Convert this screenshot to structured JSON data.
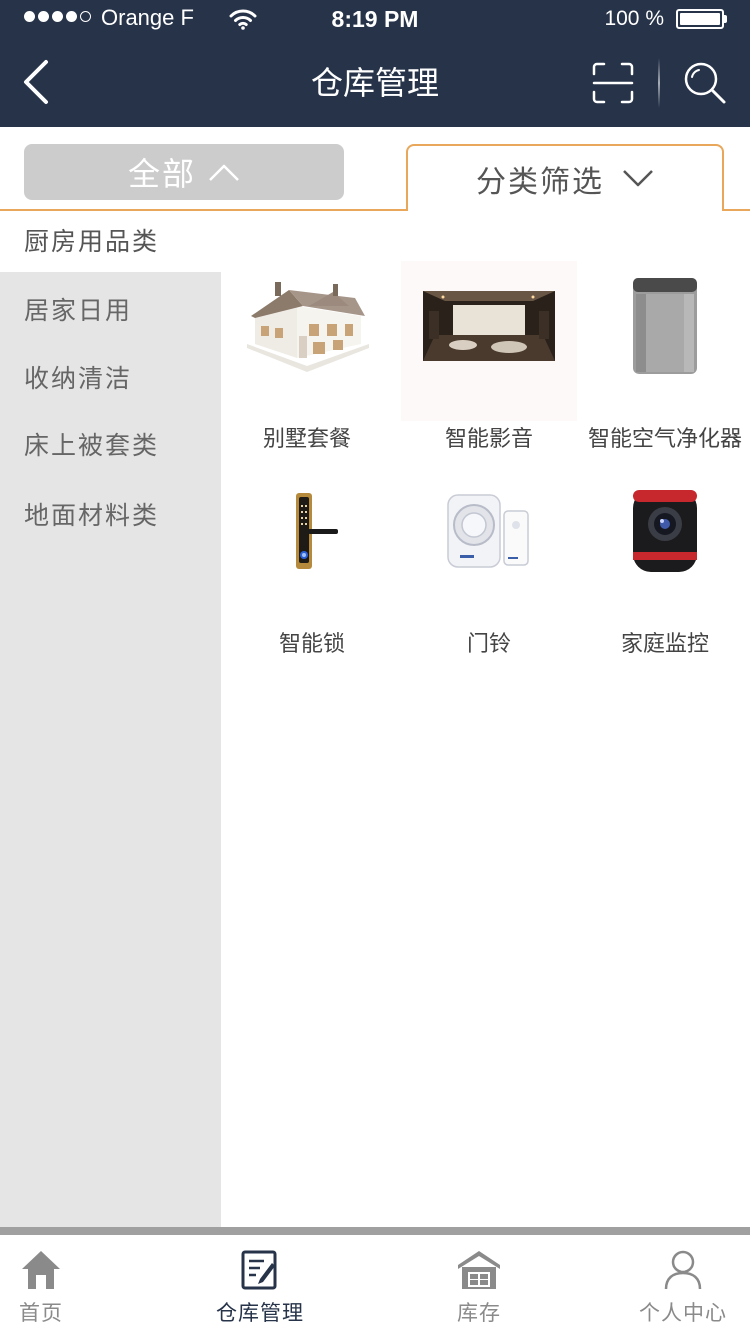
{
  "status_bar": {
    "carrier": "Orange F",
    "time": "8:19 PM",
    "battery": "100 %"
  },
  "nav": {
    "title": "仓库管理",
    "icons": [
      "chevron-left-icon",
      "scan-icon",
      "search-icon"
    ]
  },
  "filters": {
    "all_label": "全部",
    "category_label": "分类筛选"
  },
  "categories": [
    "厨房用品类",
    "居家日用",
    "收纳清洁",
    "床上被套类",
    "地面材料类"
  ],
  "products": [
    {
      "label": "别墅套餐",
      "icon": "villa-image"
    },
    {
      "label": "智能影音",
      "icon": "home-theater-image"
    },
    {
      "label": "智能空气净化器",
      "icon": "air-purifier-image"
    },
    {
      "label": "智能锁",
      "icon": "smart-lock-image"
    },
    {
      "label": "门铃",
      "icon": "doorbell-image"
    },
    {
      "label": "家庭监控",
      "icon": "security-camera-image"
    }
  ],
  "tabbar": {
    "items": [
      {
        "label": "首页",
        "icon": "home-icon",
        "active": false
      },
      {
        "label": "仓库管理",
        "icon": "edit-document-icon",
        "active": true
      },
      {
        "label": "库存",
        "icon": "warehouse-icon",
        "active": false
      },
      {
        "label": "个人中心",
        "icon": "person-icon",
        "active": false
      }
    ]
  },
  "colors": {
    "header_bg": "#263349",
    "accent": "#e8a75a",
    "sidebar_bg": "#e5e5e5",
    "all_tab_bg": "#cccccc"
  }
}
